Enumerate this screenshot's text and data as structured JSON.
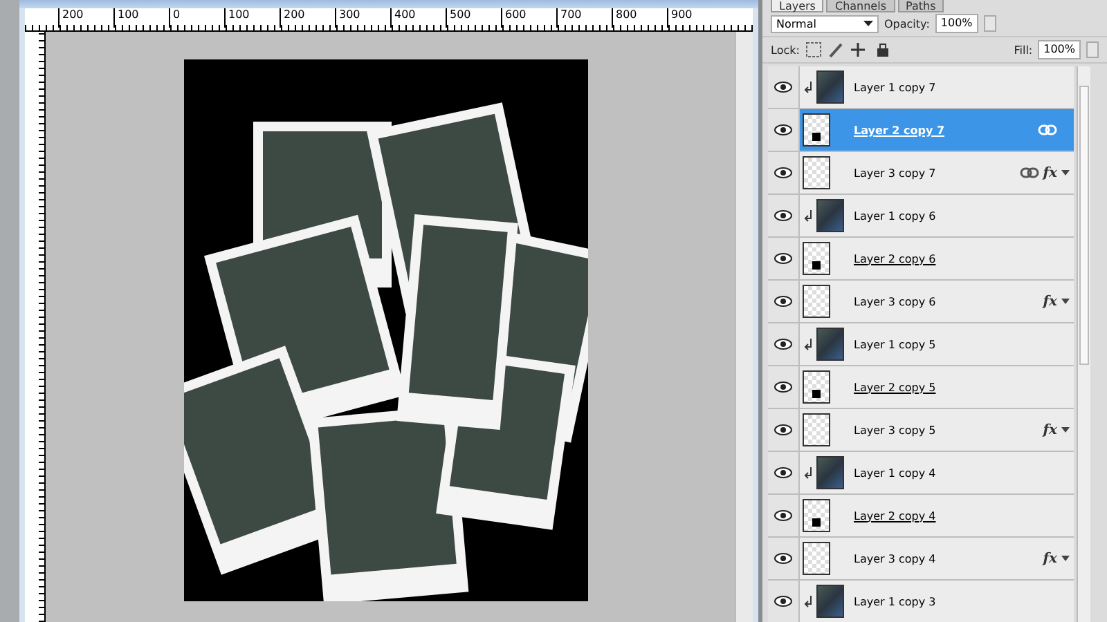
{
  "document": {
    "ruler_labels": [
      "200",
      "100",
      "0",
      "100",
      "200",
      "300",
      "400",
      "500",
      "600",
      "700",
      "800",
      "900"
    ]
  },
  "layers_panel": {
    "tabs": [
      {
        "label": "Layers",
        "selected": true
      },
      {
        "label": "Channels",
        "selected": false
      },
      {
        "label": "Paths",
        "selected": false
      }
    ],
    "blend_mode": "Normal",
    "opacity_label": "Opacity:",
    "opacity": "100%",
    "lock_label": "Lock:",
    "fill_label": "Fill:",
    "fill": "100%",
    "layers": [
      {
        "name": "Layer 1 copy 7",
        "kind": "photo",
        "selected": false,
        "visible": true,
        "clipped": true,
        "linked": false
      },
      {
        "name": "Layer 2 copy 7",
        "kind": "shape",
        "selected": true,
        "visible": true,
        "clipped": false,
        "linked": true
      },
      {
        "name": "Layer 3 copy 7",
        "kind": "frame",
        "selected": false,
        "visible": true,
        "clipped": false,
        "linked": true,
        "effects": "fx"
      },
      {
        "name": "Layer 1 copy 6",
        "kind": "photo",
        "selected": false,
        "visible": true,
        "clipped": true,
        "linked": false
      },
      {
        "name": "Layer 2 copy 6",
        "kind": "shape",
        "selected": false,
        "visible": true,
        "clipped": false,
        "linked": false
      },
      {
        "name": "Layer 3 copy 6",
        "kind": "frame",
        "selected": false,
        "visible": true,
        "clipped": false,
        "linked": false,
        "effects": "fx"
      },
      {
        "name": "Layer 1 copy 5",
        "kind": "photo",
        "selected": false,
        "visible": true,
        "clipped": true,
        "linked": false
      },
      {
        "name": "Layer 2 copy 5",
        "kind": "shape",
        "selected": false,
        "visible": true,
        "clipped": false,
        "linked": false
      },
      {
        "name": "Layer 3 copy 5",
        "kind": "frame",
        "selected": false,
        "visible": true,
        "clipped": false,
        "linked": false,
        "effects": "fx"
      },
      {
        "name": "Layer 1 copy 4",
        "kind": "photo",
        "selected": false,
        "visible": true,
        "clipped": true,
        "linked": false
      },
      {
        "name": "Layer 2 copy 4",
        "kind": "shape",
        "selected": false,
        "visible": true,
        "clipped": false,
        "linked": false
      },
      {
        "name": "Layer 3 copy 4",
        "kind": "frame",
        "selected": false,
        "visible": true,
        "clipped": false,
        "linked": false,
        "effects": "fx"
      },
      {
        "name": "Layer 1 copy 3",
        "kind": "photo",
        "selected": false,
        "visible": true,
        "clipped": true,
        "linked": false
      }
    ]
  }
}
